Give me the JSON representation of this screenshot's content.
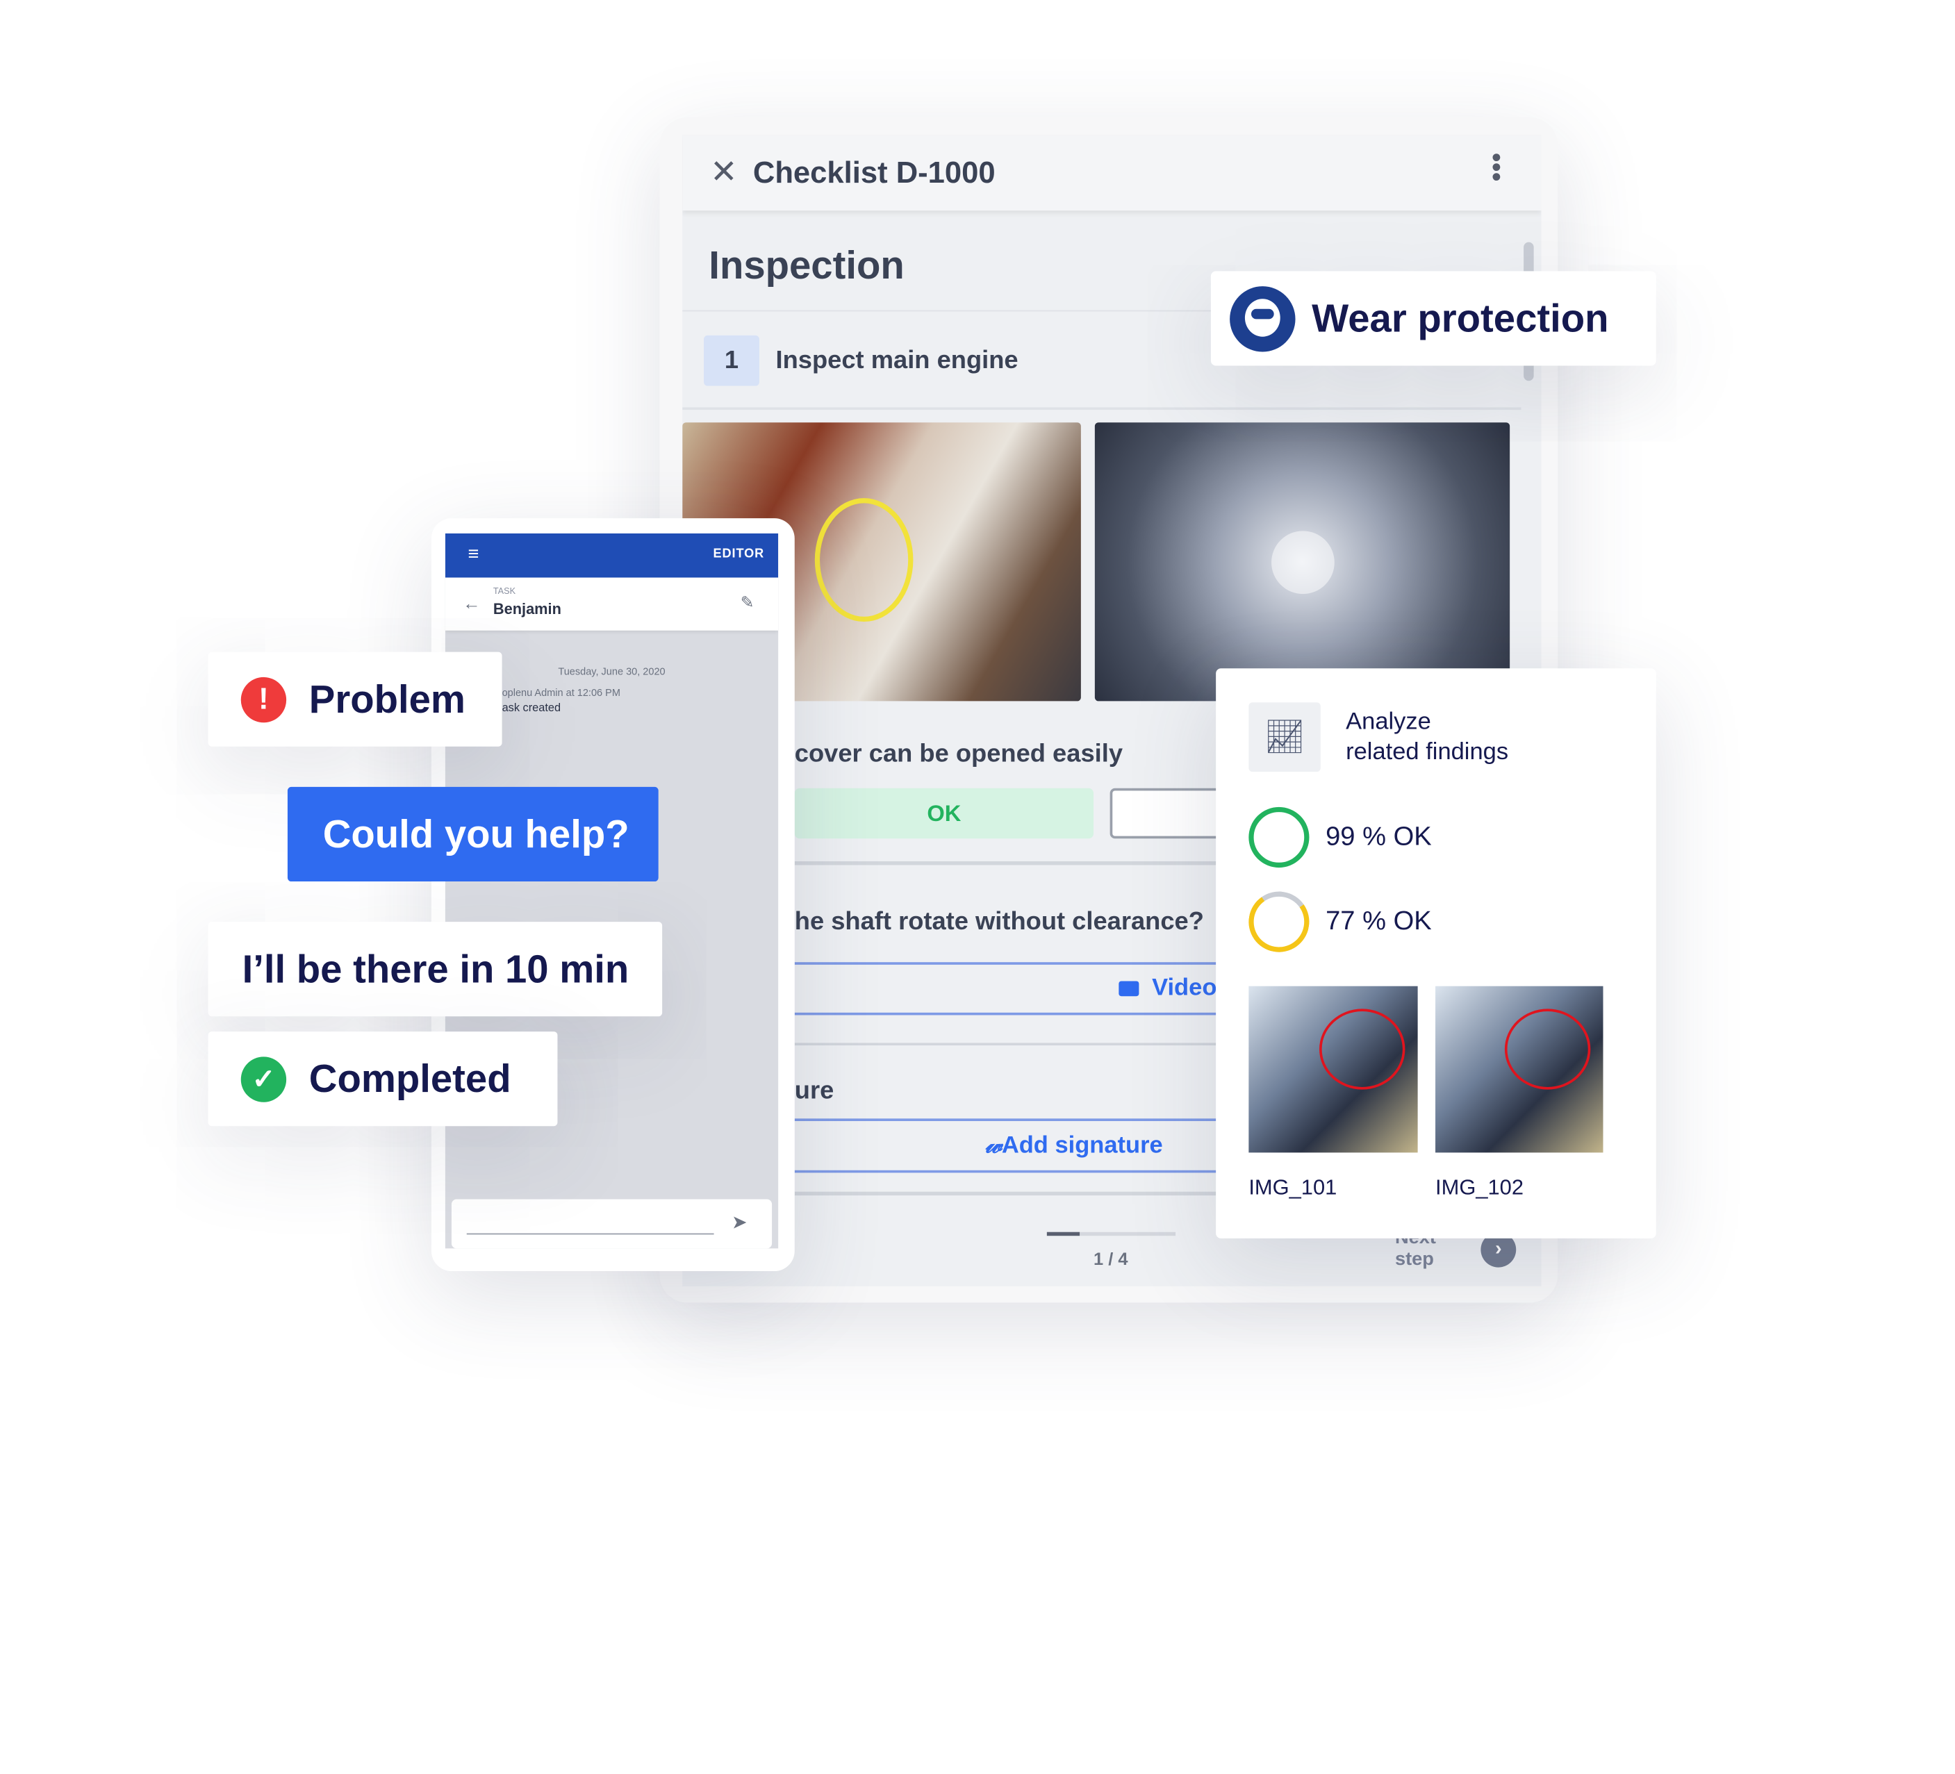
{
  "checklist": {
    "title": "Checklist D-1000",
    "section": "Inspection",
    "step_number": "1",
    "step_title": "Inspect main engine",
    "q1": "cover can be opened easily",
    "ok_label": "OK",
    "q2": "he shaft rotate without clearance?",
    "video_label": "Video",
    "q3": "ure",
    "signature_label": "Add signature",
    "pagination": "1 / 4",
    "next_label_1": "Next",
    "next_label_2": "step",
    "progress_fraction": 0.25
  },
  "wear": {
    "label": "Wear protection"
  },
  "analyze": {
    "title_1": "Analyze",
    "title_2": "related findings",
    "stats": [
      {
        "label": "99 % OK",
        "percent": 99,
        "color": "#22b35e"
      },
      {
        "label": "77 % OK",
        "percent": 77,
        "color": "#f5c518"
      }
    ],
    "images": [
      {
        "label": "IMG_101"
      },
      {
        "label": "IMG_102"
      }
    ]
  },
  "phone": {
    "header_label": "EDITOR",
    "task_caption": "TASK",
    "task_name": "Benjamin",
    "date": "Tuesday, June 30, 2020",
    "log_meta": "oplenu Admin at 12:06 PM",
    "log_text": "ask created"
  },
  "chat": {
    "problem": "Problem",
    "question": "Could you help?",
    "reply": "I’ll be there in 10 min",
    "completed": "Completed"
  },
  "colors": {
    "brand_blue": "#1f4db5",
    "bubble_blue": "#2f6bf0",
    "navy": "#15194f",
    "problem_red": "#ef3b3b",
    "ok_green": "#22b35e"
  }
}
